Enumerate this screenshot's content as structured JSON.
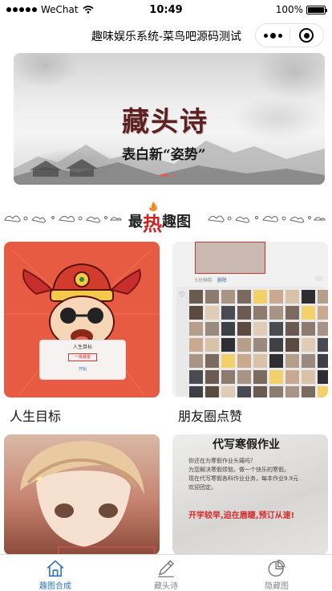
{
  "status_bar": {
    "carrier": "WeChat",
    "time": "10:49",
    "battery": "100%",
    "battery_level": 1.0
  },
  "nav": {
    "title": "趣味娱乐系统-菜鸟吧源码测试"
  },
  "banner": {
    "title": "藏头诗",
    "subtitle": "表白新“姿势”",
    "slide_count": 2,
    "active_slide": 1
  },
  "section": {
    "heading_prefix": "最",
    "heading_hot": "热",
    "heading_suffix": "趣图"
  },
  "cards": [
    {
      "label": "人生目标",
      "dialog_title": "人生目标",
      "dialog_value": "一夜暴富",
      "dialog_button": "开始"
    },
    {
      "label": "朋友圈点赞",
      "post_meta": "5分钟前",
      "post_delete": "删除"
    },
    {
      "label": ""
    },
    {
      "label": "",
      "paper_title": "代写寒假作业",
      "paper_line1": "你还在为寒假作业头痛吗？",
      "paper_line2": "为您解决寒假烦恼，做一个快乐的寒假。",
      "paper_line3": "现在代写寒假各科作业业务，每本作业9.9元",
      "paper_line4": "欢迎团定。",
      "paper_slogan": "开学较早,迫在眉睫,预订从速!"
    }
  ],
  "tabs": [
    {
      "label": "趣图合成",
      "icon": "house-icon",
      "active": true
    },
    {
      "label": "藏头诗",
      "icon": "pencil-icon",
      "active": false
    },
    {
      "label": "隐藏图",
      "icon": "pie-chart-icon",
      "active": false
    }
  ],
  "colors": {
    "accent": "#2e72c4",
    "hot_red": "#d12222",
    "god_bg": "#e85b43"
  }
}
